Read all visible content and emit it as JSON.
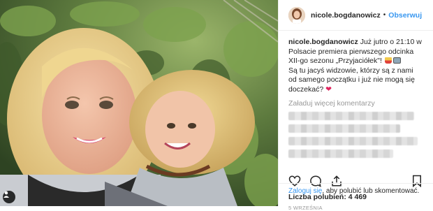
{
  "header": {
    "username": "nicole.bogdanowicz",
    "separator": "•",
    "follow_label": "Obserwuj"
  },
  "caption": {
    "username": "nicole.bogdanowicz",
    "text_part1": "Już jutro o 21:10 w Polsacie premiera pierwszego odcinka XII-go sezonu „Przyjaciółek\"!",
    "text_part2": "Są tu jacyś widzowie, którzy są z nami od samego początku i już nie mogą się doczekać?",
    "emoji_1": "fries-emoji",
    "emoji_2": "tv-emoji",
    "heart": "❤"
  },
  "comments": {
    "more_label": "Załaduj więcej komentarzy",
    "blurred_rows": 4
  },
  "actions": {
    "like_icon": "heart-icon",
    "comment_icon": "comment-icon",
    "share_icon": "share-icon",
    "save_icon": "bookmark-icon"
  },
  "likes_label": "Liczba polubień: 4 469",
  "date": "5 WRZEŚNIA",
  "login": {
    "link": "Zaloguj się",
    "rest": ", aby polubić lub skomentować."
  },
  "colors": {
    "accent": "#3897f0",
    "heart": "#e0245e",
    "muted": "#999999"
  }
}
